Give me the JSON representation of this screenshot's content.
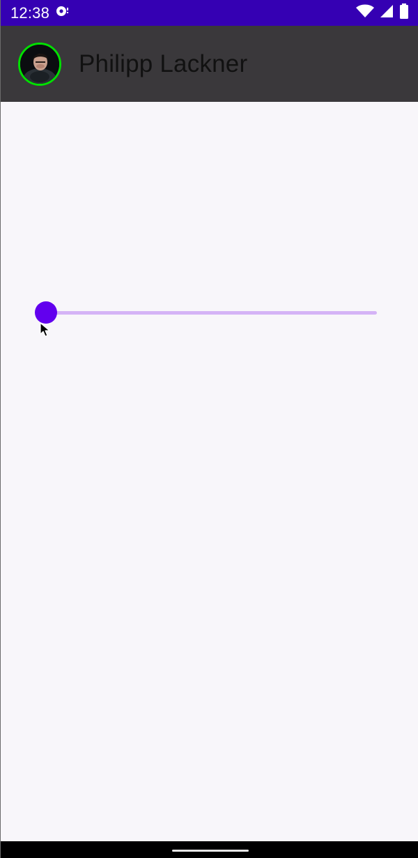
{
  "status_bar": {
    "time": "12:38",
    "icons": [
      "cast-notification-icon",
      "wifi-icon",
      "cell-signal-icon",
      "battery-icon"
    ],
    "background_color": "#3500b3"
  },
  "app_bar": {
    "title": "Philipp Lackner",
    "avatar_ring_color": "#00e000",
    "background_color": "#3a383b"
  },
  "slider": {
    "value": 0,
    "min": 0,
    "max": 1,
    "active_color": "#6200ee",
    "inactive_color": "#d5b3f6"
  },
  "cursor": {
    "icon": "mouse-pointer-icon"
  },
  "navigation_bar": {
    "icon": "gesture-handle"
  }
}
